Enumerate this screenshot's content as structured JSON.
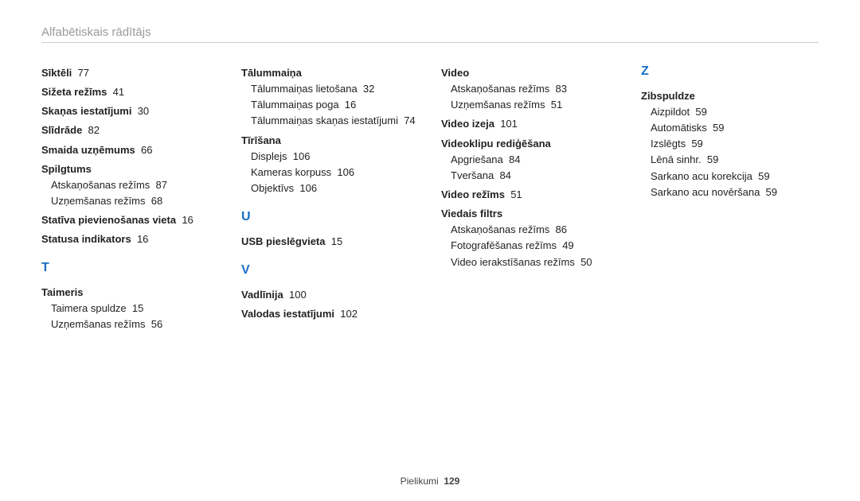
{
  "header": {
    "title": "Alfabētiskais rādītājs"
  },
  "footer": {
    "label": "Pielikumi",
    "page": "129"
  },
  "col1": {
    "items": [
      {
        "t": "Sīktēli",
        "p": "77"
      },
      {
        "t": "Sižeta režīms",
        "p": "41"
      },
      {
        "t": "Skaņas iestatījumi",
        "p": "30"
      },
      {
        "t": "Slīdrāde",
        "p": "82"
      },
      {
        "t": "Smaida uzņēmums",
        "p": "66"
      },
      {
        "t": "Spilgtums",
        "subs": [
          {
            "t": "Atskaņošanas režīms",
            "p": "87"
          },
          {
            "t": "Uzņemšanas režīms",
            "p": "68"
          }
        ]
      },
      {
        "t": "Statīva pievienošanas vieta",
        "p": "16"
      },
      {
        "t": "Statusa indikators",
        "p": "16"
      }
    ],
    "letter_t": "T",
    "t_items": [
      {
        "t": "Taimeris",
        "subs": [
          {
            "t": "Taimera spuldze",
            "p": "15"
          },
          {
            "t": "Uzņemšanas režīms",
            "p": "56"
          }
        ]
      }
    ]
  },
  "col2": {
    "items": [
      {
        "t": "Tālummaiņa",
        "subs": [
          {
            "t": "Tālummaiņas lietošana",
            "p": "32"
          },
          {
            "t": "Tālummaiņas poga",
            "p": "16"
          },
          {
            "t": "Tālummaiņas skaņas iestatījumi",
            "p": "74"
          }
        ]
      },
      {
        "t": "Tīrīšana",
        "subs": [
          {
            "t": "Displejs",
            "p": "106"
          },
          {
            "t": "Kameras korpuss",
            "p": "106"
          },
          {
            "t": "Objektīvs",
            "p": "106"
          }
        ]
      }
    ],
    "letter_u": "U",
    "u_items": [
      {
        "t": "USB pieslēgvieta",
        "p": "15"
      }
    ],
    "letter_v": "V",
    "v_items": [
      {
        "t": "Vadlīnija",
        "p": "100"
      },
      {
        "t": "Valodas iestatījumi",
        "p": "102"
      }
    ]
  },
  "col3": {
    "items": [
      {
        "t": "Video",
        "subs": [
          {
            "t": "Atskaņošanas režīms",
            "p": "83"
          },
          {
            "t": "Uzņemšanas režīms",
            "p": "51"
          }
        ]
      },
      {
        "t": "Video izeja",
        "p": "101"
      },
      {
        "t": "Videoklipu rediģēšana",
        "subs": [
          {
            "t": "Apgriešana",
            "p": "84"
          },
          {
            "t": "Tveršana",
            "p": "84"
          }
        ]
      },
      {
        "t": "Video režīms",
        "p": "51"
      },
      {
        "t": "Viedais filtrs",
        "subs": [
          {
            "t": "Atskaņošanas režīms",
            "p": "86"
          },
          {
            "t": "Fotografēšanas režīms",
            "p": "49"
          },
          {
            "t": "Video ierakstīšanas režīms",
            "p": "50"
          }
        ]
      }
    ]
  },
  "col4": {
    "letter_z": "Z",
    "items": [
      {
        "t": "Zibspuldze",
        "subs": [
          {
            "t": "Aizpildot",
            "p": "59"
          },
          {
            "t": "Automātisks",
            "p": "59"
          },
          {
            "t": "Izslēgts",
            "p": "59"
          },
          {
            "t": "Lēnā sinhr.",
            "p": "59"
          },
          {
            "t": "Sarkano acu korekcija",
            "p": "59"
          },
          {
            "t": "Sarkano acu novēršana",
            "p": "59"
          }
        ]
      }
    ]
  }
}
